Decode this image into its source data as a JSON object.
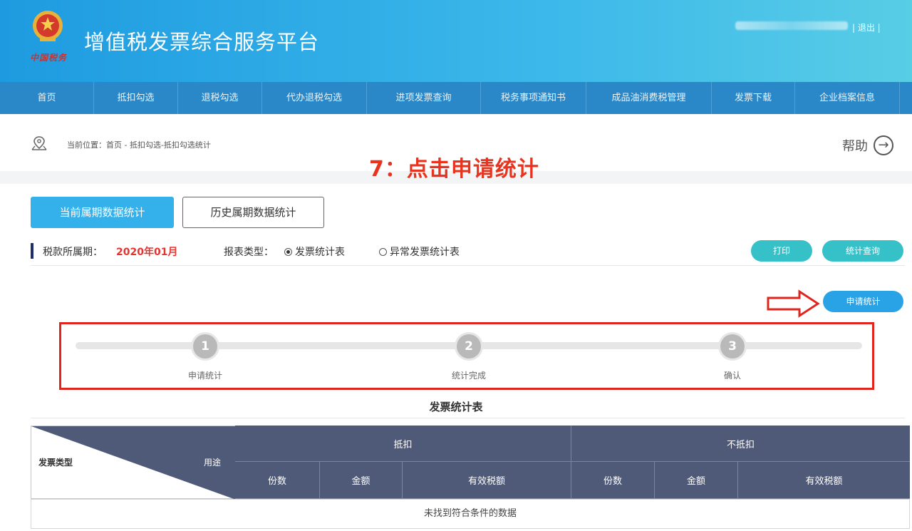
{
  "header": {
    "app_title": "增值税发票综合服务平台",
    "logo_text": "中国税务",
    "logout": "| 退出 |"
  },
  "nav": {
    "items": [
      {
        "label": "首页"
      },
      {
        "label": "抵扣勾选"
      },
      {
        "label": "退税勾选"
      },
      {
        "label": "代办退税勾选"
      },
      {
        "label": "进项发票查询"
      },
      {
        "label": "税务事项通知书"
      },
      {
        "label": "成品油消费税管理"
      },
      {
        "label": "发票下载"
      },
      {
        "label": "企业档案信息"
      }
    ]
  },
  "breadcrumb": {
    "text": "当前位置：首页 - 抵扣勾选-抵扣勾选统计"
  },
  "help": {
    "label": "帮助"
  },
  "annotation": {
    "step_note": "7：点击申请统计"
  },
  "tabs": {
    "current": "当前属期数据统计",
    "history": "历史属期数据统计"
  },
  "filters": {
    "period_label": "税款所属期：",
    "period_value": "2020年01月",
    "type_label": "报表类型：",
    "option_invoice": "发票统计表",
    "option_abnormal": "异常发票统计表",
    "selected": "发票统计表"
  },
  "actions": {
    "print": "打印",
    "stat_query": "统计查询",
    "apply_stat": "申请统计"
  },
  "steps": [
    {
      "number": "1",
      "label": "申请统计"
    },
    {
      "number": "2",
      "label": "统计完成"
    },
    {
      "number": "3",
      "label": "确认"
    }
  ],
  "table": {
    "title": "发票统计表",
    "corner_left": "发票类型",
    "corner_right": "用途",
    "group_deduct": "抵扣",
    "group_nondeduct": "不抵扣",
    "cols": {
      "count": "份数",
      "amount": "金额",
      "tax": "有效税额"
    },
    "empty": "未找到符合条件的数据"
  },
  "colors": {
    "header_blue": "#1e9be0",
    "nav_blue": "#2a88c8",
    "accent_teal": "#36c1c8",
    "accent_blue": "#2aa3e6",
    "annotation_red": "#e8331f",
    "table_head": "#4f5a78"
  }
}
